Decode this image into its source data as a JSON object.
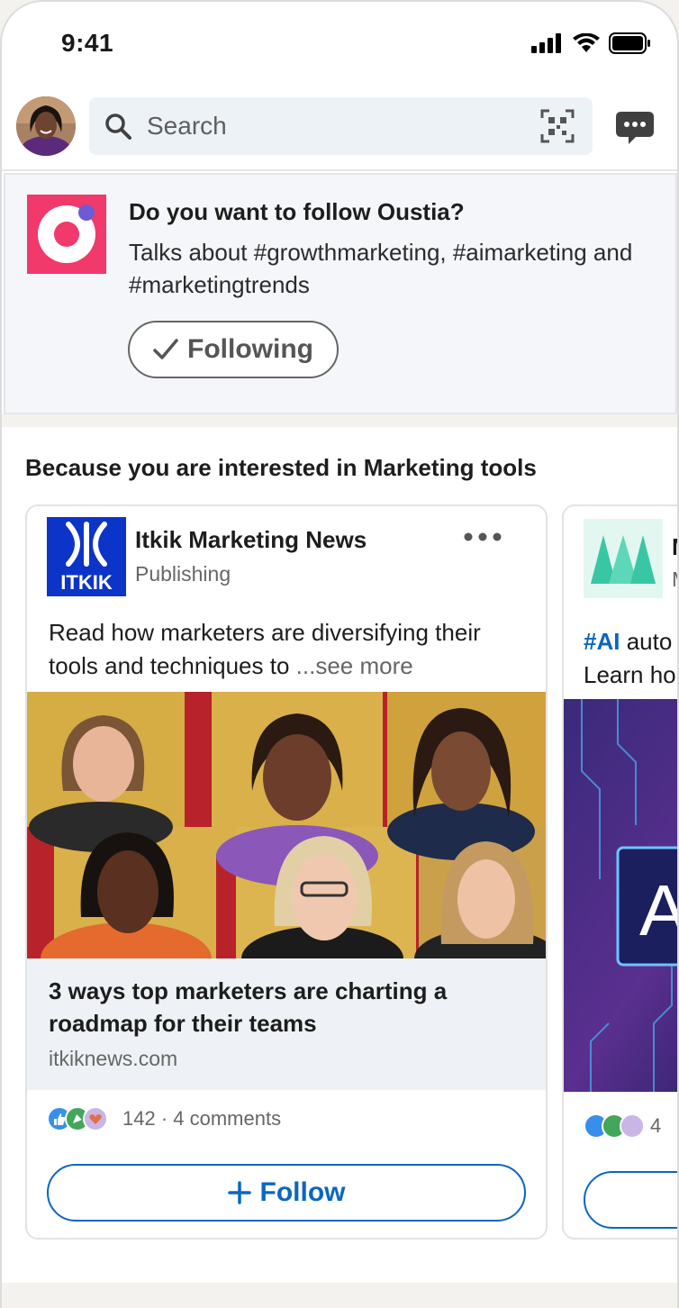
{
  "status_bar": {
    "time": "9:41"
  },
  "search": {
    "placeholder": "Search"
  },
  "follow_prompt": {
    "title": "Do you want to follow Oustia?",
    "body": "Talks about #growthmarketing, #aimarketing and #marketingtrends",
    "button_label": "Following",
    "brand_color": "#f1396b"
  },
  "section": {
    "heading": "Because you are interested in Marketing tools"
  },
  "cards": [
    {
      "publisher": "Itkik Marketing News",
      "publisher_type": "Publishing",
      "logo_text": "ITKIK",
      "logo_color": "#0d34c9",
      "post_text": "Read how marketers are diversifying their tools and techniques to",
      "see_more": "...see more",
      "link_title": "3 ways top marketers are charting a roadmap for their teams",
      "link_domain": "itkiknews.com",
      "social_counts": "142 · 4 comments",
      "follow_label": "Follow"
    },
    {
      "publisher": "M",
      "publisher_type": "M",
      "hashtag": "#AI",
      "post_text_1": " auto",
      "post_text_2": "Learn ho",
      "image_text": "A",
      "social_counts": "4"
    }
  ],
  "colors": {
    "accent": "#0a66c2",
    "card_border": "#e3e3e3"
  }
}
